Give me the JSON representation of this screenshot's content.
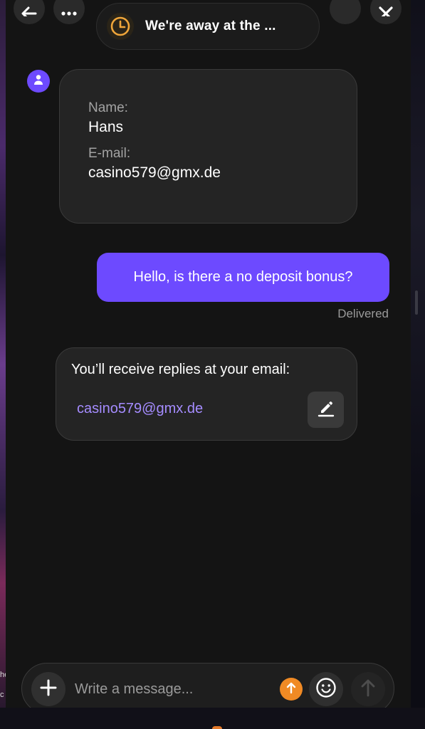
{
  "header": {
    "title": "We're away at the ...",
    "back_icon": "arrow-left-icon",
    "more_icon": "more-horizontal-icon",
    "minimize_icon": "minimize-icon",
    "close_icon": "close-icon",
    "status_icon": "clock-icon"
  },
  "avatar": {
    "icon": "user-icon",
    "color": "#6d4aff"
  },
  "contact_form": {
    "name_label": "Name:",
    "name_value": "Hans",
    "email_label": "E-mail:",
    "email_value": "casino579@gmx.de"
  },
  "outgoing_message": {
    "text": "Hello, is there a no deposit bonus?",
    "status": "Delivered",
    "color": "#6d4aff"
  },
  "reply_notice": {
    "text": "You’ll receive replies at your email:",
    "email": "casino579@gmx.de",
    "edit_icon": "pencil-icon",
    "email_color": "#a58cff"
  },
  "composer": {
    "placeholder": "Write a message...",
    "attach_icon": "plus-icon",
    "upload_icon": "arrow-up-icon",
    "upload_color": "#f08a24",
    "emoji_icon": "smiley-icon",
    "send_icon": "send-arrow-icon"
  }
}
